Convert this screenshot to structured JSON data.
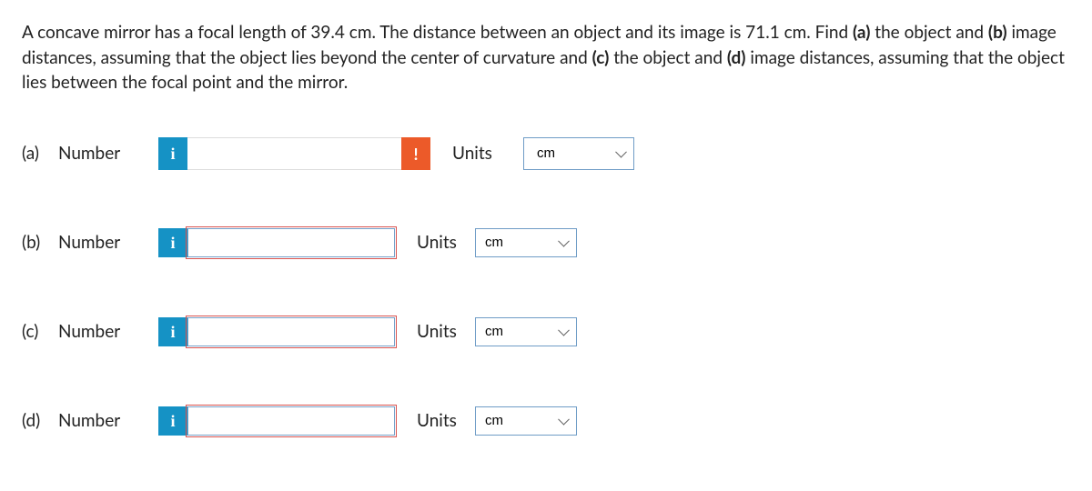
{
  "question": {
    "prefix": "A concave mirror has a focal length of 39.4 cm. The distance between an object and its image is 71.1 cm. Find ",
    "a_b": "(a)",
    "mid1": " the object and ",
    "b_b": "(b)",
    "mid2": " image distances, assuming that the object lies beyond the center of curvature and ",
    "c_b": "(c)",
    "mid3": " the object and ",
    "d_b": "(d)",
    "suffix": " image distances, assuming that the object lies between the focal point and the mirror."
  },
  "labels": {
    "number": "Number",
    "units": "Units",
    "info": "i",
    "warn": "!"
  },
  "parts": {
    "a": {
      "label": "(a)",
      "unit": "cm"
    },
    "b": {
      "label": "(b)",
      "unit": "cm"
    },
    "c": {
      "label": "(c)",
      "unit": "cm"
    },
    "d": {
      "label": "(d)",
      "unit": "cm"
    }
  }
}
